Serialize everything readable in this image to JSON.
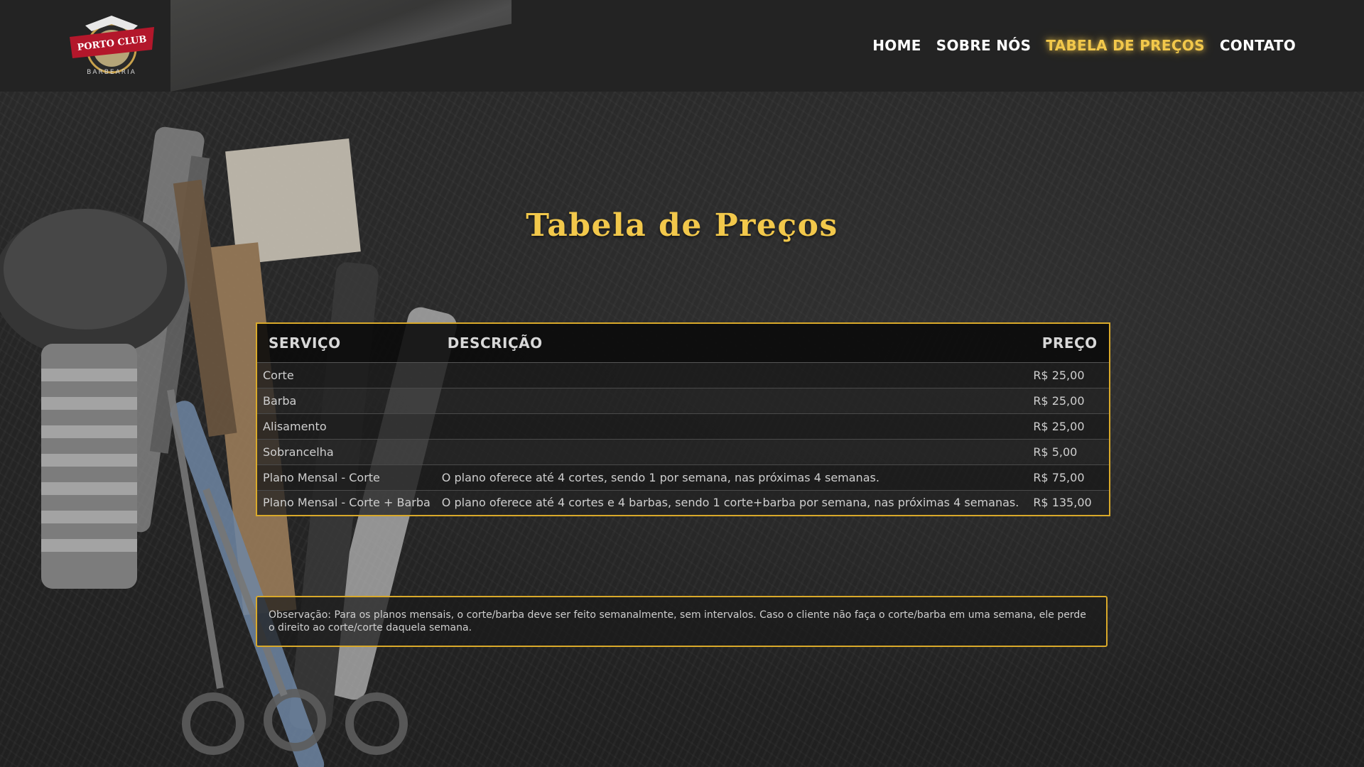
{
  "brand": {
    "logo_top": "PORTO CLUB",
    "logo_bottom": "BARBEARIA"
  },
  "nav": {
    "items": [
      {
        "label": "HOME",
        "active": false
      },
      {
        "label": "SOBRE NÓS",
        "active": false
      },
      {
        "label": "TABELA DE PREÇOS",
        "active": true
      },
      {
        "label": "CONTATO",
        "active": false
      }
    ]
  },
  "page_title": "Tabela de Preços",
  "table": {
    "headers": {
      "service": "SERVIÇO",
      "description": "DESCRIÇÃO",
      "price": "PREÇO"
    },
    "rows": [
      {
        "service": "Corte",
        "description": "",
        "price": "R$ 25,00"
      },
      {
        "service": "Barba",
        "description": "",
        "price": "R$ 25,00"
      },
      {
        "service": "Alisamento",
        "description": "",
        "price": "R$ 25,00"
      },
      {
        "service": "Sobrancelha",
        "description": "",
        "price": "R$ 5,00"
      },
      {
        "service": "Plano Mensal - Corte",
        "description": "O plano oferece até 4 cortes, sendo 1 por semana, nas próximas 4 semanas.",
        "price": "R$ 75,00"
      },
      {
        "service": "Plano Mensal - Corte + Barba",
        "description": "O plano oferece até 4 cortes e 4 barbas, sendo 1 corte+barba por semana, nas próximas 4 semanas.",
        "price": "R$ 135,00"
      }
    ]
  },
  "note": "Observação: Para os planos mensais, o corte/barba deve ser feito semanalmente, sem intervalos. Caso o cliente não faça o corte/barba em uma semana, ele perde o direito ao corte/corte daquela semana.",
  "colors": {
    "accent": "#f2c84b",
    "border": "#d9a92a",
    "header_bg": "#232323",
    "logo_red": "#b3172b"
  }
}
